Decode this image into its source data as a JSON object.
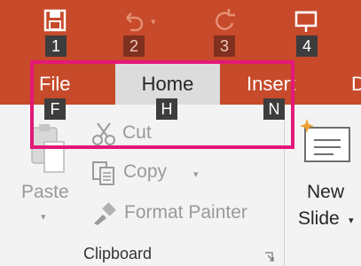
{
  "ribbon": {
    "tabs": [
      {
        "label": "File"
      },
      {
        "label": "Home"
      },
      {
        "label": "Insert"
      },
      {
        "label": "D"
      }
    ],
    "qat_key_tips": [
      "1",
      "2",
      "3",
      "4"
    ],
    "tab_key_tips": [
      "F",
      "H",
      "N"
    ],
    "clipboard": {
      "paste_label": "Paste",
      "cut_label": "Cut",
      "copy_label": "Copy",
      "format_painter_label": "Format Painter",
      "group_label": "Clipboard"
    },
    "slides": {
      "new_slide_line1": "New",
      "new_slide_line2": "Slide"
    }
  },
  "colors": {
    "accent": "#c74a2a",
    "highlight": "#e41878",
    "key_tip": "#3d3d3d",
    "ribbon_bg": "#f3f3f3"
  },
  "icons": {
    "save": "save-icon",
    "undo": "undo-icon",
    "redo": "redo-icon",
    "start_from_beginning": "slideshow-icon",
    "paste": "clipboard-icon",
    "cut": "scissors-icon",
    "copy": "copy-icon",
    "format_painter": "paintbrush-icon",
    "new_slide": "new-slide-icon",
    "dialog_launcher": "dialog-launcher-icon"
  }
}
